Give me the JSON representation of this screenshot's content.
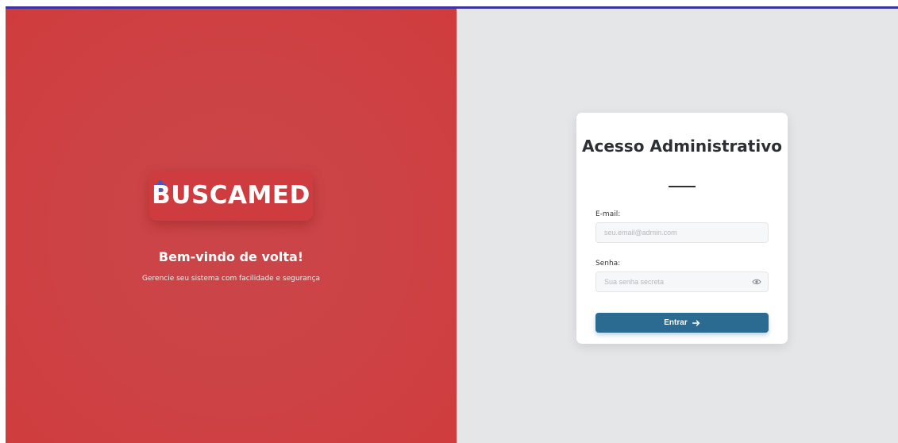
{
  "brand": {
    "logo_text": "BUSCAMED",
    "welcome_title": "Bem-vindo de volta!",
    "welcome_subtitle": "Gerencie seu sistema com facilidade e segurança",
    "panel_color": "#cc4346"
  },
  "login": {
    "title": "Acesso Administrativo",
    "email_label": "E-mail:",
    "email_placeholder": "seu.email@admin.com",
    "email_value": "",
    "password_label": "Senha:",
    "password_placeholder": "Sua senha secreta",
    "password_value": "",
    "submit_label": "Entrar",
    "submit_color": "#2c6b91",
    "icons": {
      "password_toggle": "eye-icon",
      "submit_arrow": "arrow-right-icon"
    }
  }
}
